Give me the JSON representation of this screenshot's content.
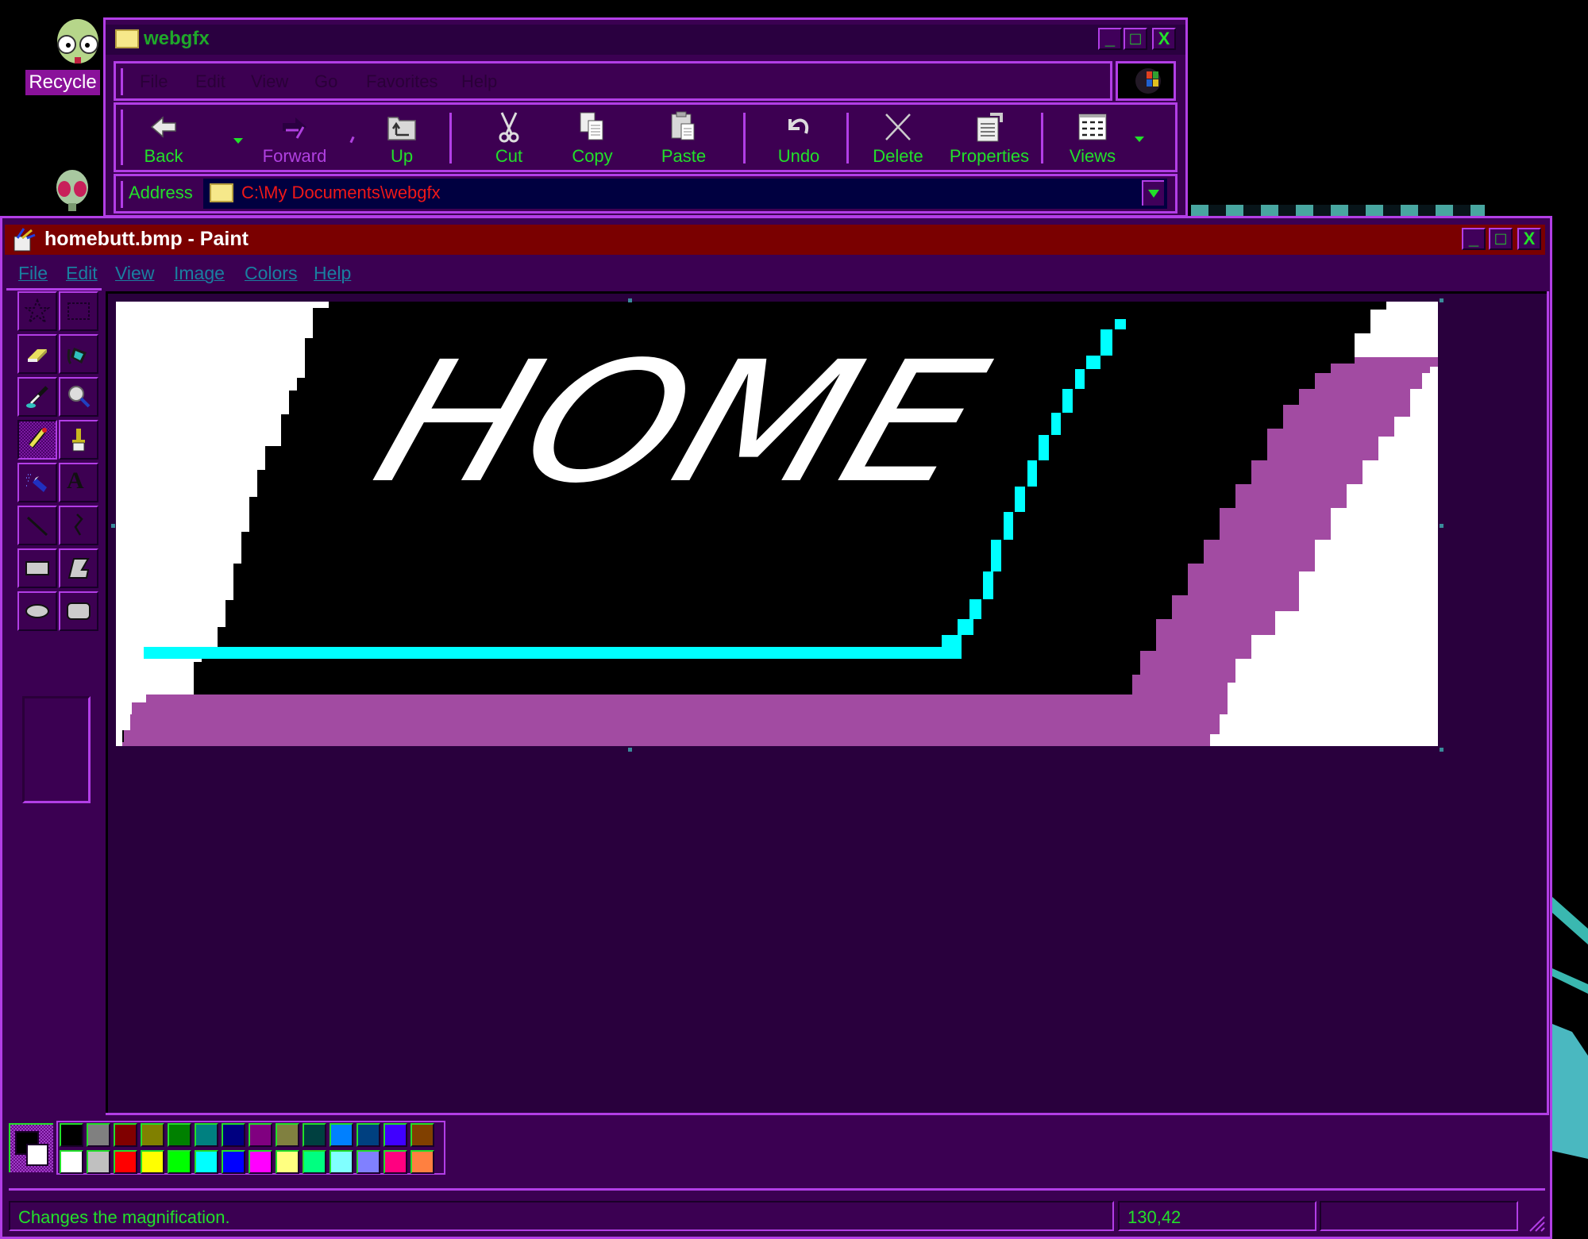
{
  "desktop": {
    "icons": [
      {
        "name": "recycle",
        "label": "Recycle"
      },
      {
        "name": "alien",
        "label": ""
      }
    ]
  },
  "explorer_window": {
    "title": "webgfx",
    "menu": [
      "File",
      "Edit",
      "View",
      "Go",
      "Favorites",
      "Help"
    ],
    "toolbar": [
      {
        "id": "back",
        "label": "Back",
        "icon": "back-arrow-icon",
        "has_dropdown": true,
        "enabled": true
      },
      {
        "id": "forward",
        "label": "Forward",
        "icon": "forward-arrow-icon",
        "has_dropdown": true,
        "enabled": false
      },
      {
        "id": "up",
        "label": "Up",
        "icon": "up-folder-icon",
        "enabled": true
      },
      {
        "id": "cut",
        "label": "Cut",
        "icon": "scissors-icon",
        "enabled": true
      },
      {
        "id": "copy",
        "label": "Copy",
        "icon": "copy-icon",
        "enabled": true
      },
      {
        "id": "paste",
        "label": "Paste",
        "icon": "paste-icon",
        "enabled": true
      },
      {
        "id": "undo",
        "label": "Undo",
        "icon": "undo-icon",
        "enabled": true
      },
      {
        "id": "delete",
        "label": "Delete",
        "icon": "delete-x-icon",
        "enabled": true
      },
      {
        "id": "properties",
        "label": "Properties",
        "icon": "properties-icon",
        "enabled": true
      },
      {
        "id": "views",
        "label": "Views",
        "icon": "views-icon",
        "has_dropdown": true,
        "enabled": true
      }
    ],
    "address": {
      "label": "Address",
      "value": "C:\\My Documents\\webgfx"
    }
  },
  "paint_window": {
    "title": "homebutt.bmp - Paint",
    "menu": [
      "File",
      "Edit",
      "View",
      "Image",
      "Colors",
      "Help"
    ],
    "tools": [
      {
        "id": "free-form-select",
        "active": false
      },
      {
        "id": "select",
        "active": false
      },
      {
        "id": "eraser",
        "active": false
      },
      {
        "id": "fill-with-color",
        "active": false
      },
      {
        "id": "pick-color",
        "active": false
      },
      {
        "id": "magnifier",
        "active": false
      },
      {
        "id": "pencil",
        "active": true
      },
      {
        "id": "brush",
        "active": false
      },
      {
        "id": "airbrush",
        "active": false
      },
      {
        "id": "text",
        "active": false,
        "glyph": "A"
      },
      {
        "id": "line",
        "active": false
      },
      {
        "id": "curve",
        "active": false
      },
      {
        "id": "rectangle",
        "active": false
      },
      {
        "id": "polygon",
        "active": false
      },
      {
        "id": "ellipse",
        "active": false
      },
      {
        "id": "rounded-rectangle",
        "active": false
      }
    ],
    "image": {
      "text": "HOME",
      "colors": {
        "background": "#000000",
        "corner": "#ffffff",
        "accent_line": "#00ffff",
        "shadow": "#a24ba2"
      }
    },
    "palette": {
      "foreground": "#000000",
      "background": "#ffffff",
      "top_row": [
        "#000000",
        "#808080",
        "#800000",
        "#808000",
        "#008000",
        "#008080",
        "#000080",
        "#800080",
        "#808040",
        "#004040",
        "#0080ff",
        "#004080",
        "#4000ff",
        "#804000"
      ],
      "bottom_row": [
        "#ffffff",
        "#c0c0c0",
        "#ff0000",
        "#ffff00",
        "#00ff00",
        "#00ffff",
        "#0000ff",
        "#ff00ff",
        "#ffff80",
        "#00ff80",
        "#80ffff",
        "#8080ff",
        "#ff0080",
        "#ff8040"
      ]
    },
    "status": {
      "message": "Changes the magnification.",
      "coordinates": "130,42",
      "size": ""
    }
  },
  "theme": {
    "border": "#b23ee6",
    "window_bg": "#3b0052",
    "text_green": "#22e02a",
    "paint_title_bg": "#7a0000",
    "address_text": "#f01818"
  }
}
